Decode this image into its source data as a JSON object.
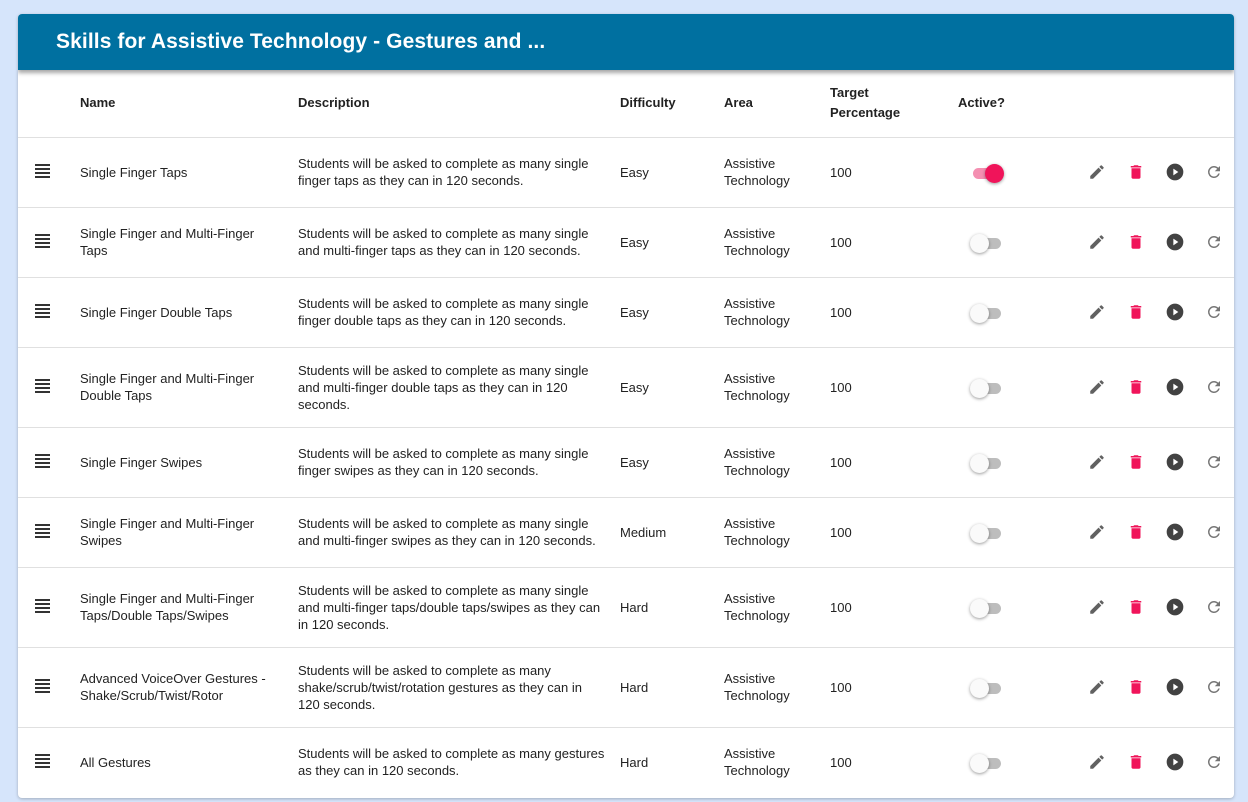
{
  "header": {
    "title": "Skills for Assistive Technology - Gestures and ..."
  },
  "columns": {
    "name": "Name",
    "description": "Description",
    "difficulty": "Difficulty",
    "area": "Area",
    "target_line1": "Target",
    "target_line2": "Percentage",
    "active": "Active?"
  },
  "colors": {
    "header": "#0070a0",
    "accent": "#f0145a",
    "icon": "#616161"
  },
  "icons": [
    "drag-handle-icon",
    "pencil-icon",
    "trash-icon",
    "play-circle-icon",
    "refresh-icon"
  ],
  "rows": [
    {
      "name": "Single Finger Taps",
      "description": "Students will be asked to complete as many single finger taps as they can in 120 seconds.",
      "difficulty": "Easy",
      "area": "Assistive Technology",
      "target": "100",
      "active": true
    },
    {
      "name": "Single Finger and Multi-Finger Taps",
      "description": "Students will be asked to complete as many single and multi-finger taps as they can in 120 seconds.",
      "difficulty": "Easy",
      "area": "Assistive Technology",
      "target": "100",
      "active": false
    },
    {
      "name": "Single Finger Double Taps",
      "description": "Students will be asked to complete as many single finger double taps as they can in 120 seconds.",
      "difficulty": "Easy",
      "area": "Assistive Technology",
      "target": "100",
      "active": false
    },
    {
      "name": "Single Finger and Multi-Finger Double Taps",
      "description": "Students will be asked to complete as many single and multi-finger double taps as they can in 120 seconds.",
      "difficulty": "Easy",
      "area": "Assistive Technology",
      "target": "100",
      "active": false
    },
    {
      "name": "Single Finger Swipes",
      "description": "Students will be asked to complete as many single finger swipes as they can in 120 seconds.",
      "difficulty": "Easy",
      "area": "Assistive Technology",
      "target": "100",
      "active": false
    },
    {
      "name": "Single Finger and Multi-Finger Swipes",
      "description": "Students will be asked to complete as many single and multi-finger swipes as they can in 120 seconds.",
      "difficulty": "Medium",
      "area": "Assistive Technology",
      "target": "100",
      "active": false
    },
    {
      "name": "Single Finger and Multi-Finger Taps/Double Taps/Swipes",
      "description": "Students will be asked to complete as many single and multi-finger taps/double taps/swipes as they can in 120 seconds.",
      "difficulty": "Hard",
      "area": "Assistive Technology",
      "target": "100",
      "active": false
    },
    {
      "name": "Advanced VoiceOver Gestures - Shake/Scrub/Twist/Rotor",
      "description": "Students will be asked to complete as many shake/scrub/twist/rotation gestures as they can in 120 seconds.",
      "difficulty": "Hard",
      "area": "Assistive Technology",
      "target": "100",
      "active": false
    },
    {
      "name": "All Gestures",
      "description": "Students will be asked to complete as many gestures as they can in 120 seconds.",
      "difficulty": "Hard",
      "area": "Assistive Technology",
      "target": "100",
      "active": false
    }
  ]
}
